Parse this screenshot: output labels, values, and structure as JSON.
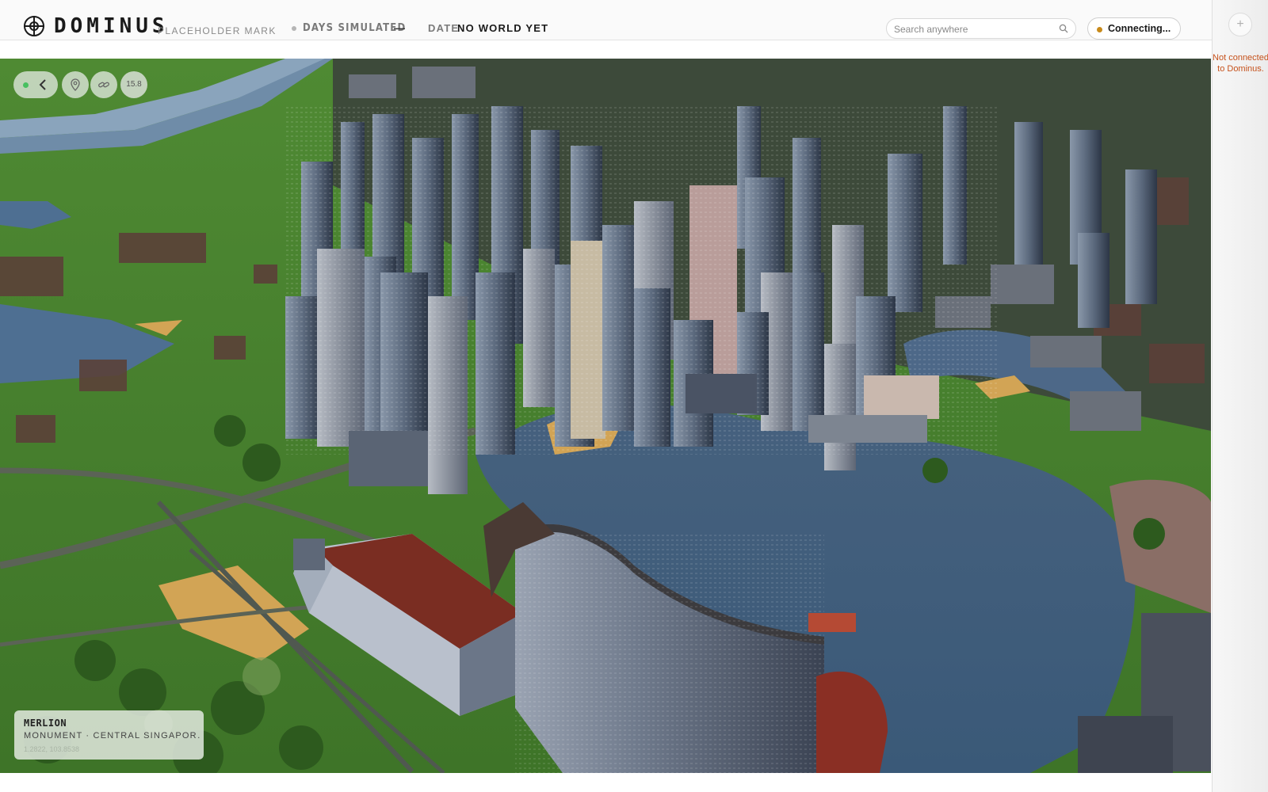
{
  "header": {
    "brand": "DOMINUS",
    "brand_sub": "PLACEHOLDER MARK",
    "days_label": "DAYS SIMULATED",
    "days_value": "—",
    "date_label": "DATE",
    "date_value": "NO WORLD YET"
  },
  "search": {
    "placeholder": "Search anywhere"
  },
  "connection": {
    "label": "Connecting...",
    "dot_color": "#c88a1a"
  },
  "sidebar": {
    "add_label": "+",
    "message": "Not connected to Dominus."
  },
  "map_controls": {
    "zoom": "15.8",
    "live_color": "#48c060"
  },
  "place": {
    "name": "MERLION",
    "type": "MONUMENT · CENTRAL SINGAPOR…",
    "coords": "1.2822, 103.8538"
  },
  "icons": [
    "target-logo-icon",
    "search-icon",
    "chevron-left-icon",
    "map-pin-icon",
    "link-icon"
  ]
}
